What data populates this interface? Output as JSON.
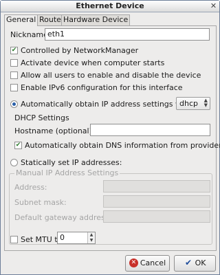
{
  "window": {
    "title": "Ethernet Device"
  },
  "tabs": [
    {
      "label": "General",
      "mnemonic": "G",
      "active": true
    },
    {
      "label": "Route",
      "active": false
    },
    {
      "label": "Hardware Device",
      "mnemonic": "H",
      "active": false
    }
  ],
  "general": {
    "nickname_label": "Nickname:",
    "nickname_value": "eth1",
    "checks": [
      {
        "label": "Controlled by NetworkManager",
        "checked": true
      },
      {
        "label": "Activate device when computer starts",
        "checked": false
      },
      {
        "label": "Allow all users to enable and disable the device",
        "checked": false
      },
      {
        "label": "Enable IPv6 configuration for this interface",
        "checked": false
      }
    ],
    "auto_ip": {
      "label": "Automatically obtain IP address settings with:",
      "selected": true,
      "method": "dhcp"
    },
    "dhcp": {
      "title": "DHCP Settings",
      "hostname_label": "Hostname (optional):",
      "hostname_value": "",
      "dns_label": "Automatically obtain DNS information from provider",
      "dns_checked": true
    },
    "static_ip": {
      "label": "Statically set IP addresses:",
      "selected": false,
      "group_title": "Manual IP Address Settings",
      "address_label": "Address:",
      "subnet_label": "Subnet mask:",
      "gateway_label": "Default gateway address:"
    },
    "mtu": {
      "label": "Set MTU to:",
      "checked": false,
      "value": "0"
    }
  },
  "buttons": {
    "cancel": "Cancel",
    "ok": "OK"
  }
}
